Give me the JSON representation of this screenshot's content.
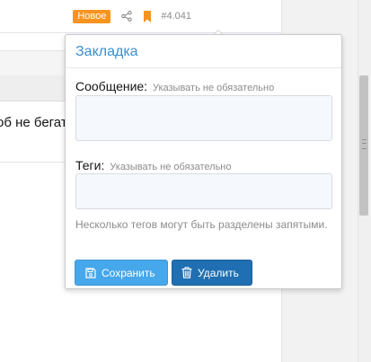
{
  "post": {
    "badge_new": "Новое",
    "number": "#4.041",
    "share_icon": "share-icon",
    "bookmark_icon": "bookmark-icon"
  },
  "background": {
    "message_fragment": "об не бегат"
  },
  "bookmark_popup": {
    "title": "Закладка",
    "message": {
      "label": "Сообщение:",
      "hint": "Указывать не обязательно",
      "value": ""
    },
    "tags": {
      "label": "Теги:",
      "hint": "Указывать не обязательно",
      "value": ""
    },
    "tags_explain": "Несколько тегов могут быть разделены запятыми.",
    "save_button": {
      "label": "Сохранить",
      "icon": "save-icon"
    },
    "delete_button": {
      "label": "Удалить",
      "icon": "trash-icon"
    }
  },
  "colors": {
    "badge": "#f7941d",
    "title": "#3a8fd1",
    "save": "#47a7eb",
    "delete": "#1f6fb2"
  }
}
